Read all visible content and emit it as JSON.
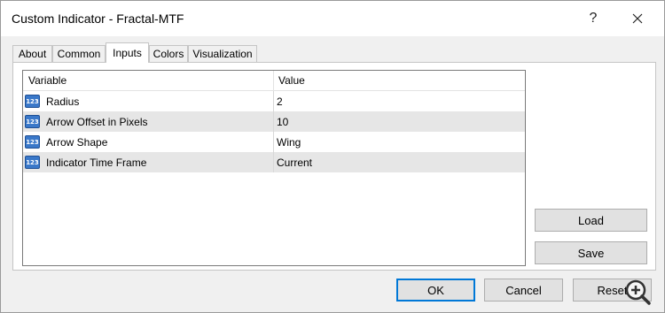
{
  "window": {
    "title": "Custom Indicator - Fractal-MTF",
    "help": "?",
    "close_icon": "close-icon"
  },
  "tabs": [
    {
      "label": "About"
    },
    {
      "label": "Common"
    },
    {
      "label": "Inputs",
      "active": true
    },
    {
      "label": "Colors"
    },
    {
      "label": "Visualization"
    }
  ],
  "grid": {
    "headers": {
      "variable": "Variable",
      "value": "Value"
    },
    "rows": [
      {
        "icon": "numeric-type-icon",
        "icon_text": "123",
        "variable": "Radius",
        "value": "2"
      },
      {
        "icon": "numeric-type-icon",
        "icon_text": "123",
        "variable": "Arrow Offset in Pixels",
        "value": "10"
      },
      {
        "icon": "numeric-type-icon",
        "icon_text": "123",
        "variable": "Arrow Shape",
        "value": "Wing"
      },
      {
        "icon": "numeric-type-icon",
        "icon_text": "123",
        "variable": "Indicator Time Frame",
        "value": "Current"
      }
    ]
  },
  "side_buttons": {
    "load": "Load",
    "save": "Save"
  },
  "footer_buttons": {
    "ok": "OK",
    "cancel": "Cancel",
    "reset": "Reset"
  },
  "colors": {
    "accent": "#0078d7",
    "row_alt": "#e6e6e6",
    "icon_blue": "#3a78c9"
  }
}
